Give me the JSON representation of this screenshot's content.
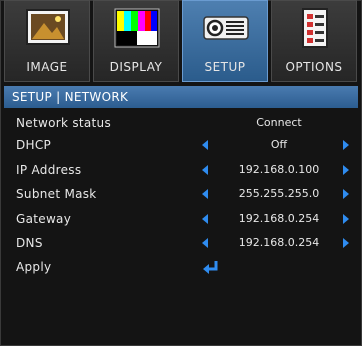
{
  "tabs": [
    {
      "label": "IMAGE",
      "icon": "image-icon",
      "active": false
    },
    {
      "label": "DISPLAY",
      "icon": "display-icon",
      "active": false
    },
    {
      "label": "SETUP",
      "icon": "projector-icon",
      "active": true
    },
    {
      "label": "OPTIONS",
      "icon": "options-icon",
      "active": false
    }
  ],
  "breadcrumb": "SETUP | NETWORK",
  "rows": [
    {
      "label": "Network status",
      "value": "Connect"
    },
    {
      "label": "DHCP",
      "value": "Off"
    },
    {
      "label": "IP Address",
      "value": "192.168.0.100"
    },
    {
      "label": "Subnet Mask",
      "value": "255.255.255.0"
    },
    {
      "label": "Gateway",
      "value": "192.168.0.254"
    },
    {
      "label": "DNS",
      "value": "192.168.0.254"
    },
    {
      "label": "Apply",
      "value": ""
    }
  ],
  "colors": {
    "accent": "#2f8cf0",
    "header": "#3a6ea3",
    "background": "#141414"
  }
}
